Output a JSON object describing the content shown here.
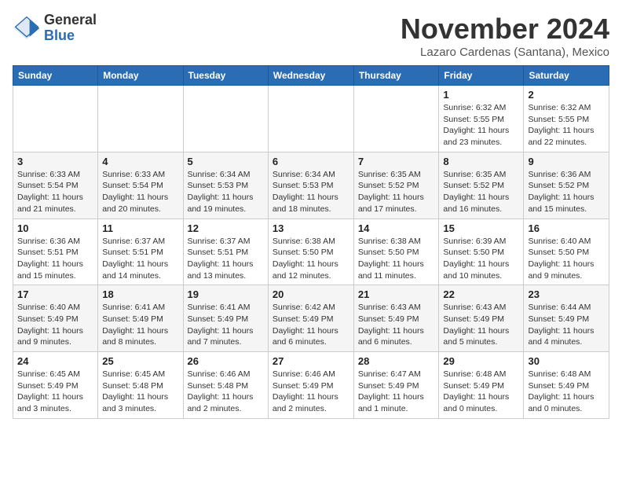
{
  "header": {
    "logo_general": "General",
    "logo_blue": "Blue",
    "title": "November 2024",
    "location": "Lazaro Cardenas (Santana), Mexico"
  },
  "days_of_week": [
    "Sunday",
    "Monday",
    "Tuesday",
    "Wednesday",
    "Thursday",
    "Friday",
    "Saturday"
  ],
  "weeks": [
    [
      {
        "day": "",
        "info": ""
      },
      {
        "day": "",
        "info": ""
      },
      {
        "day": "",
        "info": ""
      },
      {
        "day": "",
        "info": ""
      },
      {
        "day": "",
        "info": ""
      },
      {
        "day": "1",
        "info": "Sunrise: 6:32 AM\nSunset: 5:55 PM\nDaylight: 11 hours and 23 minutes."
      },
      {
        "day": "2",
        "info": "Sunrise: 6:32 AM\nSunset: 5:55 PM\nDaylight: 11 hours and 22 minutes."
      }
    ],
    [
      {
        "day": "3",
        "info": "Sunrise: 6:33 AM\nSunset: 5:54 PM\nDaylight: 11 hours and 21 minutes."
      },
      {
        "day": "4",
        "info": "Sunrise: 6:33 AM\nSunset: 5:54 PM\nDaylight: 11 hours and 20 minutes."
      },
      {
        "day": "5",
        "info": "Sunrise: 6:34 AM\nSunset: 5:53 PM\nDaylight: 11 hours and 19 minutes."
      },
      {
        "day": "6",
        "info": "Sunrise: 6:34 AM\nSunset: 5:53 PM\nDaylight: 11 hours and 18 minutes."
      },
      {
        "day": "7",
        "info": "Sunrise: 6:35 AM\nSunset: 5:52 PM\nDaylight: 11 hours and 17 minutes."
      },
      {
        "day": "8",
        "info": "Sunrise: 6:35 AM\nSunset: 5:52 PM\nDaylight: 11 hours and 16 minutes."
      },
      {
        "day": "9",
        "info": "Sunrise: 6:36 AM\nSunset: 5:52 PM\nDaylight: 11 hours and 15 minutes."
      }
    ],
    [
      {
        "day": "10",
        "info": "Sunrise: 6:36 AM\nSunset: 5:51 PM\nDaylight: 11 hours and 15 minutes."
      },
      {
        "day": "11",
        "info": "Sunrise: 6:37 AM\nSunset: 5:51 PM\nDaylight: 11 hours and 14 minutes."
      },
      {
        "day": "12",
        "info": "Sunrise: 6:37 AM\nSunset: 5:51 PM\nDaylight: 11 hours and 13 minutes."
      },
      {
        "day": "13",
        "info": "Sunrise: 6:38 AM\nSunset: 5:50 PM\nDaylight: 11 hours and 12 minutes."
      },
      {
        "day": "14",
        "info": "Sunrise: 6:38 AM\nSunset: 5:50 PM\nDaylight: 11 hours and 11 minutes."
      },
      {
        "day": "15",
        "info": "Sunrise: 6:39 AM\nSunset: 5:50 PM\nDaylight: 11 hours and 10 minutes."
      },
      {
        "day": "16",
        "info": "Sunrise: 6:40 AM\nSunset: 5:50 PM\nDaylight: 11 hours and 9 minutes."
      }
    ],
    [
      {
        "day": "17",
        "info": "Sunrise: 6:40 AM\nSunset: 5:49 PM\nDaylight: 11 hours and 9 minutes."
      },
      {
        "day": "18",
        "info": "Sunrise: 6:41 AM\nSunset: 5:49 PM\nDaylight: 11 hours and 8 minutes."
      },
      {
        "day": "19",
        "info": "Sunrise: 6:41 AM\nSunset: 5:49 PM\nDaylight: 11 hours and 7 minutes."
      },
      {
        "day": "20",
        "info": "Sunrise: 6:42 AM\nSunset: 5:49 PM\nDaylight: 11 hours and 6 minutes."
      },
      {
        "day": "21",
        "info": "Sunrise: 6:43 AM\nSunset: 5:49 PM\nDaylight: 11 hours and 6 minutes."
      },
      {
        "day": "22",
        "info": "Sunrise: 6:43 AM\nSunset: 5:49 PM\nDaylight: 11 hours and 5 minutes."
      },
      {
        "day": "23",
        "info": "Sunrise: 6:44 AM\nSunset: 5:49 PM\nDaylight: 11 hours and 4 minutes."
      }
    ],
    [
      {
        "day": "24",
        "info": "Sunrise: 6:45 AM\nSunset: 5:49 PM\nDaylight: 11 hours and 3 minutes."
      },
      {
        "day": "25",
        "info": "Sunrise: 6:45 AM\nSunset: 5:48 PM\nDaylight: 11 hours and 3 minutes."
      },
      {
        "day": "26",
        "info": "Sunrise: 6:46 AM\nSunset: 5:48 PM\nDaylight: 11 hours and 2 minutes."
      },
      {
        "day": "27",
        "info": "Sunrise: 6:46 AM\nSunset: 5:49 PM\nDaylight: 11 hours and 2 minutes."
      },
      {
        "day": "28",
        "info": "Sunrise: 6:47 AM\nSunset: 5:49 PM\nDaylight: 11 hours and 1 minute."
      },
      {
        "day": "29",
        "info": "Sunrise: 6:48 AM\nSunset: 5:49 PM\nDaylight: 11 hours and 0 minutes."
      },
      {
        "day": "30",
        "info": "Sunrise: 6:48 AM\nSunset: 5:49 PM\nDaylight: 11 hours and 0 minutes."
      }
    ]
  ]
}
